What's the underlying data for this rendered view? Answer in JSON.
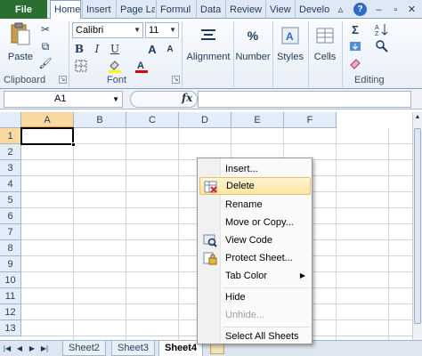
{
  "ribbon_tabs": {
    "file": "File",
    "home": "Home",
    "insert": "Insert",
    "page_layout": "Page La",
    "formulas": "Formul",
    "data": "Data",
    "review": "Review",
    "view": "View",
    "developer": "Develo"
  },
  "window_controls": {
    "help": "?"
  },
  "clipboard": {
    "paste": "Paste",
    "label": "Clipboard"
  },
  "font": {
    "name": "Calibri",
    "size": "11",
    "label": "Font",
    "bold": "B",
    "italic": "I",
    "underline": "U",
    "grow": "A",
    "shrink": "A"
  },
  "alignment": {
    "label": "Alignment"
  },
  "number": {
    "label": "Number",
    "symbol": "%"
  },
  "styles": {
    "label": "Styles"
  },
  "cells": {
    "label": "Cells"
  },
  "editing": {
    "label": "Editing",
    "sum": "Σ"
  },
  "formula_bar": {
    "name_box": "A1",
    "fx": "fx"
  },
  "grid": {
    "columns": [
      "A",
      "B",
      "C",
      "D",
      "E",
      "F"
    ],
    "rows": [
      "1",
      "2",
      "3",
      "4",
      "5",
      "6",
      "7",
      "8",
      "9",
      "10",
      "11",
      "12",
      "13"
    ],
    "selected_cell": "A1"
  },
  "sheet_tabs": [
    "Sheet2",
    "Sheet3",
    "Sheet4"
  ],
  "active_sheet": "Sheet4",
  "context_menu": {
    "insert": "Insert...",
    "delete": "Delete",
    "rename": "Rename",
    "move_copy": "Move or Copy...",
    "view_code": "View Code",
    "protect_sheet": "Protect Sheet...",
    "tab_color": "Tab Color",
    "hide": "Hide",
    "unhide": "Unhide...",
    "select_all": "Select All Sheets"
  },
  "colors": {
    "file_tab": "#2a6f2f",
    "highlight_fill": "#ffe6a0",
    "selected_header": "#f9d99f"
  }
}
